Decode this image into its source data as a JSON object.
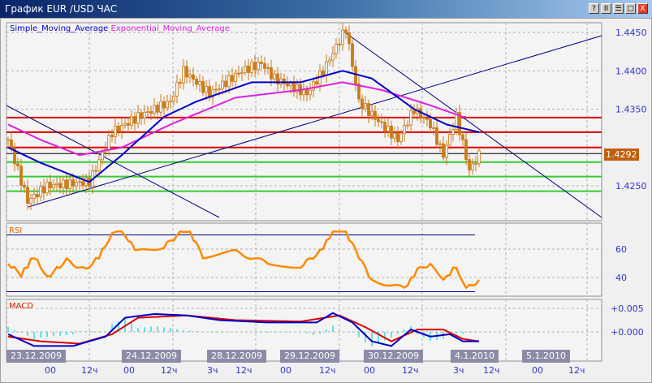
{
  "window": {
    "title": "График EUR /USD  ЧАС",
    "buttons": [
      "?",
      "II",
      "☰",
      "□",
      "X"
    ]
  },
  "legend": {
    "sma": "Simple_Moving_Average",
    "ema": "Exponential_Moving_Average"
  },
  "panels": {
    "rsi": "RSI",
    "macd": "MACD"
  },
  "current_price": "1.4292",
  "colors": {
    "sma": "#0000cc",
    "ema": "#dd22dd",
    "candle": "#cc7a1a",
    "rsi": "#ff8800",
    "resistance": "#dd0000",
    "support": "#33cc33",
    "trend": "#000080"
  },
  "x_axis": {
    "dates": [
      "23.12.2009",
      "24.12.2009",
      "28.12.2009",
      "29.12.2009",
      "30.12.2009",
      "4.1.2010",
      "5.1.2010"
    ],
    "hours": [
      "00",
      "12ч",
      "00",
      "12ч",
      "3ч",
      "12ч",
      "00",
      "12ч",
      "00",
      "12ч",
      "3ч",
      "12ч",
      "00",
      "12ч"
    ]
  },
  "chart_data": [
    {
      "type": "candlestick",
      "title": "EUR/USD H1",
      "y_ticks": [
        "1.4450",
        "1.4400",
        "1.4350",
        "1.4250"
      ],
      "ylim": [
        1.42,
        1.4462
      ],
      "close_keypoints": [
        [
          0,
          1.431
        ],
        [
          6,
          1.423
        ],
        [
          12,
          1.425
        ],
        [
          25,
          1.4255
        ],
        [
          32,
          1.432
        ],
        [
          40,
          1.434
        ],
        [
          50,
          1.436
        ],
        [
          54,
          1.44
        ],
        [
          62,
          1.437
        ],
        [
          72,
          1.44
        ],
        [
          78,
          1.441
        ],
        [
          82,
          1.439
        ],
        [
          92,
          1.437
        ],
        [
          97,
          1.44
        ],
        [
          104,
          1.4455
        ],
        [
          108,
          1.436
        ],
        [
          115,
          1.433
        ],
        [
          120,
          1.431
        ],
        [
          125,
          1.435
        ],
        [
          130,
          1.433
        ],
        [
          134,
          1.429
        ],
        [
          138,
          1.434
        ],
        [
          142,
          1.427
        ],
        [
          145,
          1.429
        ]
      ],
      "sma_keypoints": [
        [
          0,
          1.43
        ],
        [
          10,
          1.428
        ],
        [
          25,
          1.4255
        ],
        [
          35,
          1.429
        ],
        [
          48,
          1.434
        ],
        [
          58,
          1.436
        ],
        [
          75,
          1.4385
        ],
        [
          90,
          1.4385
        ],
        [
          103,
          1.44
        ],
        [
          112,
          1.439
        ],
        [
          125,
          1.435
        ],
        [
          135,
          1.433
        ],
        [
          145,
          1.432
        ]
      ],
      "ema_keypoints": [
        [
          0,
          1.433
        ],
        [
          10,
          1.431
        ],
        [
          22,
          1.429
        ],
        [
          35,
          1.43
        ],
        [
          50,
          1.433
        ],
        [
          70,
          1.4365
        ],
        [
          90,
          1.4375
        ],
        [
          103,
          1.4385
        ],
        [
          115,
          1.4375
        ],
        [
          130,
          1.4355
        ],
        [
          140,
          1.434
        ]
      ],
      "levels": {
        "resistance": [
          1.4339,
          1.432,
          1.43
        ],
        "current": 1.4292,
        "support": [
          1.4281,
          1.4262,
          1.4243
        ]
      }
    },
    {
      "type": "line",
      "title": "RSI",
      "y_ticks": [
        "60",
        "40"
      ],
      "ylim": [
        25,
        80
      ],
      "levels": [
        70,
        30
      ],
      "keypoints": [
        [
          0,
          50
        ],
        [
          4,
          42
        ],
        [
          8,
          55
        ],
        [
          12,
          40
        ],
        [
          18,
          52
        ],
        [
          24,
          45
        ],
        [
          28,
          55
        ],
        [
          32,
          70
        ],
        [
          35,
          72
        ],
        [
          40,
          58
        ],
        [
          48,
          62
        ],
        [
          54,
          73
        ],
        [
          56,
          72
        ],
        [
          60,
          55
        ],
        [
          70,
          58
        ],
        [
          80,
          50
        ],
        [
          90,
          48
        ],
        [
          96,
          58
        ],
        [
          100,
          72
        ],
        [
          104,
          72
        ],
        [
          108,
          55
        ],
        [
          112,
          38
        ],
        [
          118,
          35
        ],
        [
          122,
          32
        ],
        [
          126,
          45
        ],
        [
          130,
          50
        ],
        [
          134,
          38
        ],
        [
          138,
          48
        ],
        [
          141,
          32
        ],
        [
          145,
          38
        ]
      ]
    },
    {
      "type": "line",
      "title": "MACD",
      "y_ticks": [
        "+0.005",
        "+0.000"
      ],
      "ylim": [
        -0.004,
        0.007
      ],
      "macd_keypoints": [
        [
          0,
          -0.0005
        ],
        [
          8,
          -0.003
        ],
        [
          20,
          -0.003
        ],
        [
          30,
          -0.001
        ],
        [
          36,
          0.003
        ],
        [
          45,
          0.0038
        ],
        [
          55,
          0.0035
        ],
        [
          65,
          0.0025
        ],
        [
          80,
          0.002
        ],
        [
          95,
          0.002
        ],
        [
          100,
          0.004
        ],
        [
          106,
          0.002
        ],
        [
          112,
          -0.002
        ],
        [
          118,
          -0.003
        ],
        [
          124,
          0.0005
        ],
        [
          130,
          -0.001
        ],
        [
          136,
          -0.0005
        ],
        [
          140,
          -0.002
        ],
        [
          145,
          -0.002
        ]
      ],
      "signal_keypoints": [
        [
          0,
          -0.001
        ],
        [
          10,
          -0.002
        ],
        [
          22,
          -0.0025
        ],
        [
          32,
          -0.0005
        ],
        [
          40,
          0.003
        ],
        [
          55,
          0.0035
        ],
        [
          70,
          0.0025
        ],
        [
          90,
          0.0022
        ],
        [
          102,
          0.0035
        ],
        [
          110,
          0.001
        ],
        [
          118,
          -0.002
        ],
        [
          126,
          0.0005
        ],
        [
          134,
          0.0005
        ],
        [
          140,
          -0.0015
        ],
        [
          145,
          -0.002
        ]
      ]
    }
  ]
}
